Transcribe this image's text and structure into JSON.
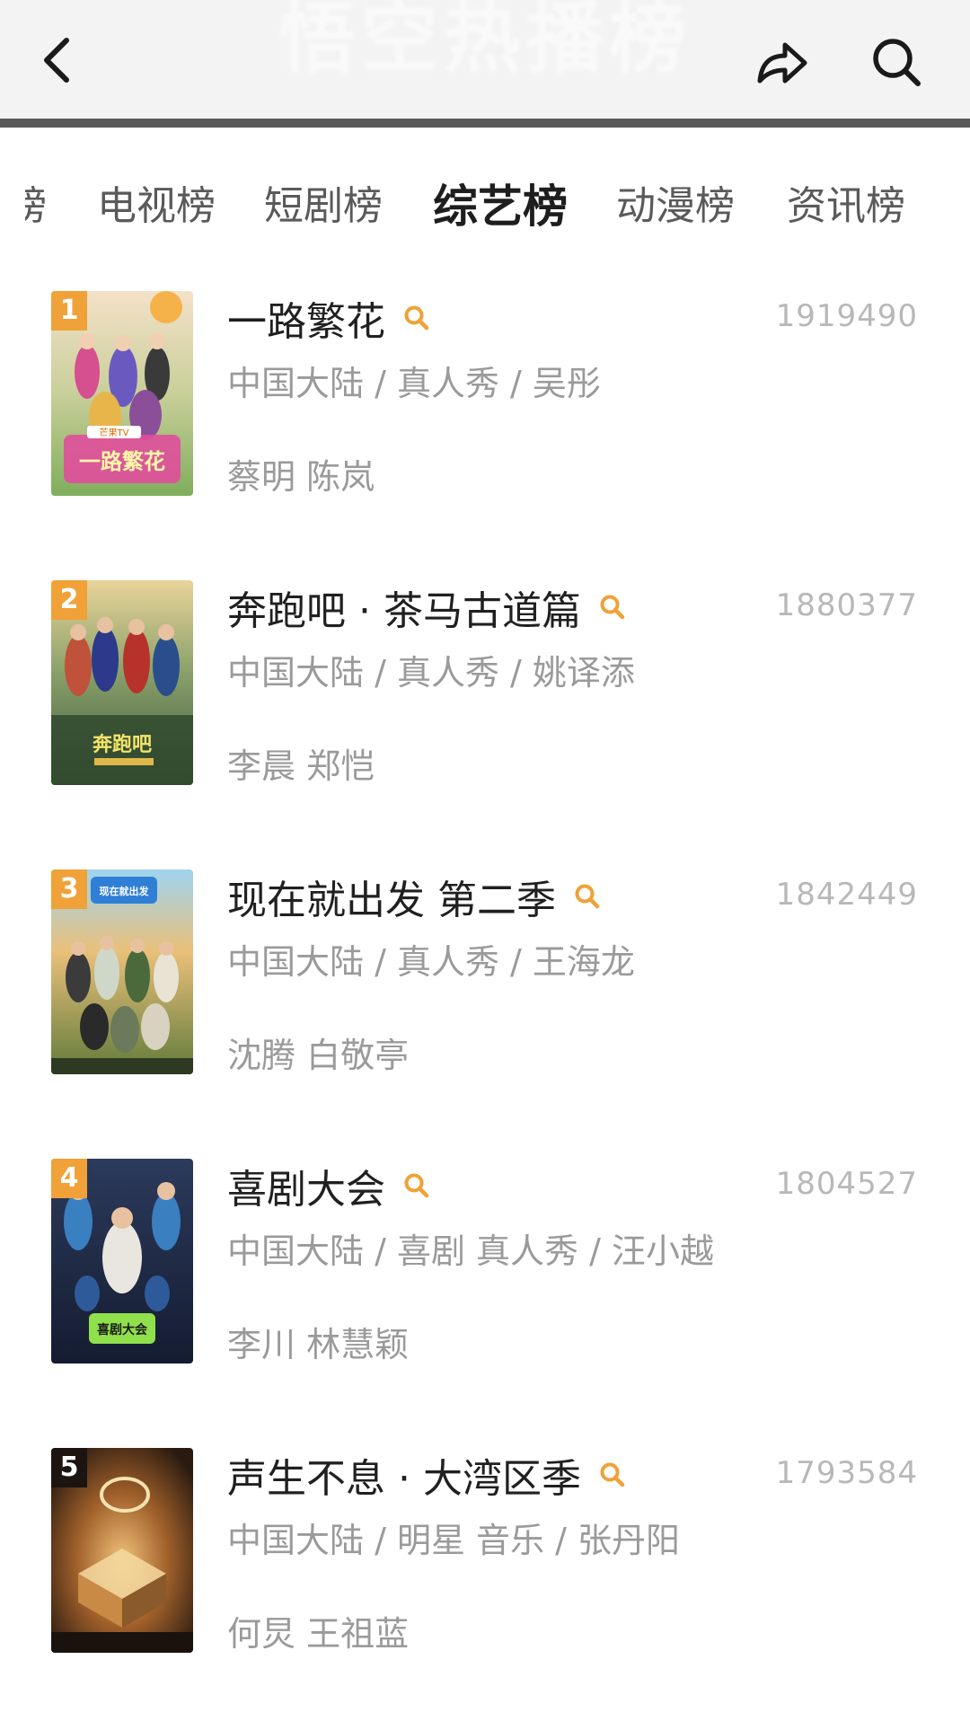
{
  "header": {
    "title": "悟空热播榜",
    "back_icon": "chevron-left-icon",
    "share_icon": "share-arrow-icon",
    "search_icon": "search-icon"
  },
  "tabs": {
    "partial": "榜",
    "items": [
      {
        "label": "电视榜"
      },
      {
        "label": "短剧榜"
      },
      {
        "label": "综艺榜",
        "active": true
      },
      {
        "label": "动漫榜"
      },
      {
        "label": "资讯榜"
      }
    ]
  },
  "colors": {
    "rank_badge": "#f0a138",
    "search_accent": "#f0a138",
    "rank5_badge": "#1b1410"
  },
  "list": [
    {
      "rank": "1",
      "title": "一路繁花",
      "score": "1919490",
      "meta": "中国大陆 / 真人秀 / 吴彤",
      "cast": "蔡明 陈岚",
      "poster_logo": "一路繁花",
      "poster_badge": "芒果TV"
    },
    {
      "rank": "2",
      "title": "奔跑吧 · 茶马古道篇",
      "score": "1880377",
      "meta": "中国大陆 / 真人秀 / 姚译添",
      "cast": "李晨 郑恺",
      "poster_logo": "奔跑吧"
    },
    {
      "rank": "3",
      "title": "现在就出发 第二季",
      "score": "1842449",
      "meta": "中国大陆 / 真人秀 / 王海龙",
      "cast": "沈腾 白敬亭",
      "poster_logo": "现在就出发"
    },
    {
      "rank": "4",
      "title": "喜剧大会",
      "score": "1804527",
      "meta": "中国大陆 / 喜剧 真人秀 / 汪小越",
      "cast": "李川 林慧颖",
      "poster_logo": "喜剧大会"
    },
    {
      "rank": "5",
      "title": "声生不息 · 大湾区季",
      "score": "1793584",
      "meta": "中国大陆 / 明星 音乐 / 张丹阳",
      "cast": "何炅 王祖蓝"
    }
  ]
}
